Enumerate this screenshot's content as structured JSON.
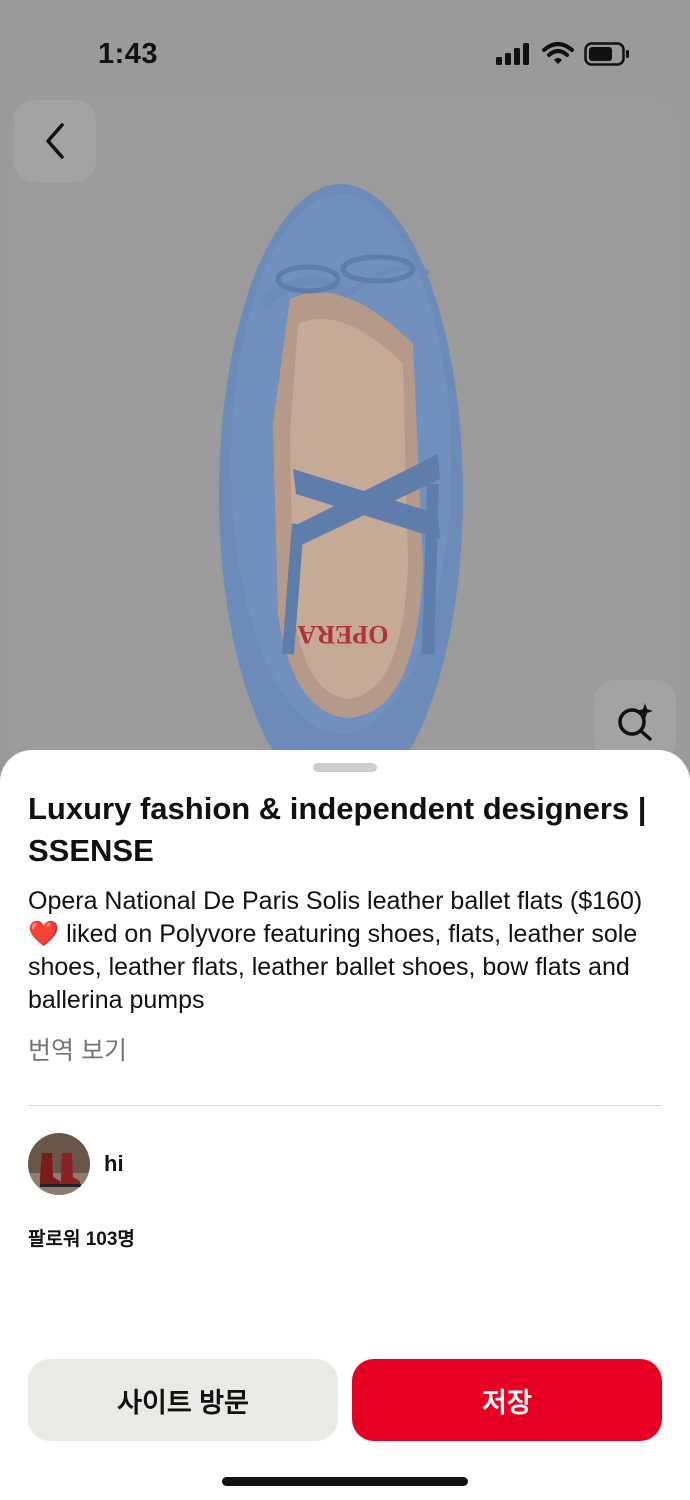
{
  "status_bar": {
    "time": "1:43"
  },
  "pin": {
    "title": "Luxury fashion & independent designers | SSENSE",
    "description": "Opera National De Paris Solis leather ballet flats ($160) ❤️ liked on Polyvore featuring shoes, flats, leather sole shoes, leather flats, leather ballet shoes, bow flats and ballerina pumps",
    "translate_label": "번역 보기",
    "insole_brand": "OPERA"
  },
  "creator": {
    "name": "hi",
    "followers_label": "팔로워 103명"
  },
  "actions": {
    "visit_label": "사이트 방문",
    "save_label": "저장"
  },
  "colors": {
    "accent": "#e60023",
    "secondary_button": "#e9e9e6",
    "dim_overlay": "#9a9a9a",
    "shoe_blue": "#6d8bb8"
  },
  "icons": [
    "signal-icon",
    "wifi-icon",
    "battery-icon",
    "back-chevron-icon",
    "visual-search-icon"
  ]
}
